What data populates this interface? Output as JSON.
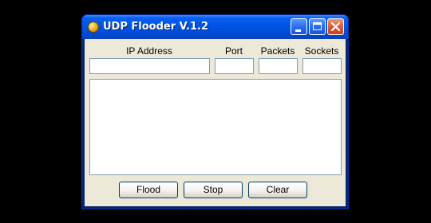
{
  "window": {
    "title": "UDP Flooder V.1.2",
    "icon": "app-orb-icon",
    "controls": {
      "minimize_icon": "minimize-icon",
      "maximize_icon": "maximize-icon",
      "close_icon": "close-icon"
    }
  },
  "form": {
    "ip_label": "IP Address",
    "port_label": "Port",
    "packets_label": "Packets",
    "sockets_label": "Sockets",
    "ip_value": "",
    "port_value": "",
    "packets_value": "",
    "sockets_value": ""
  },
  "log": {
    "content": ""
  },
  "buttons": {
    "flood": "Flood",
    "stop": "Stop",
    "clear": "Clear"
  },
  "colors": {
    "titlebar": "#0055e5",
    "close_button": "#e05a30",
    "client_background": "#ece9d8",
    "field_border": "#7f9db9",
    "button_border": "#003c74"
  }
}
